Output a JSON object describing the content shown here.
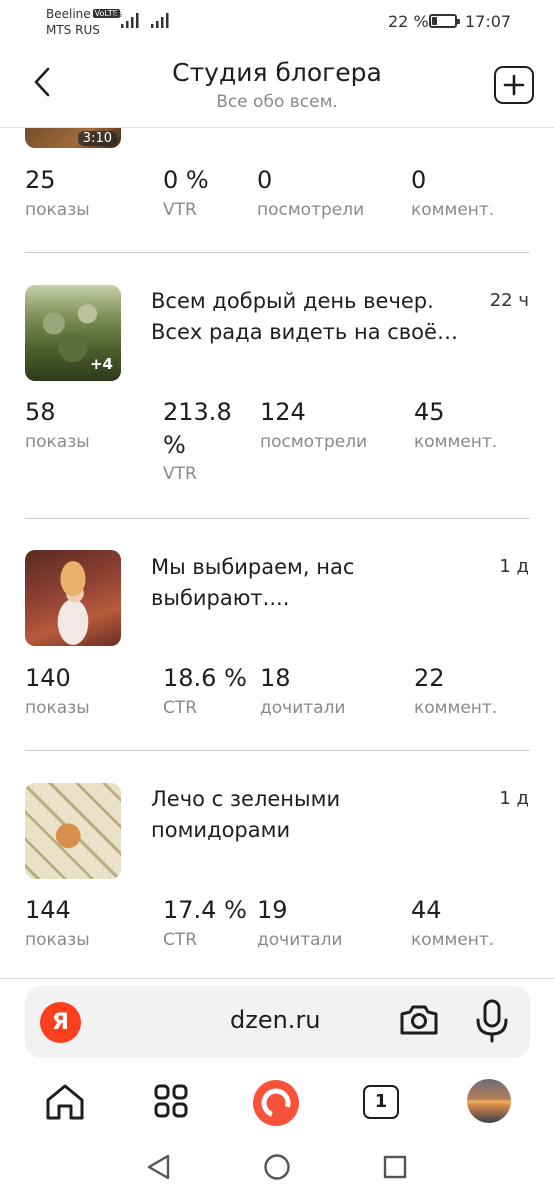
{
  "status_bar": {
    "carrier1": "Beeline",
    "volte": "VoLTE",
    "net_type": "4G",
    "carrier2": "MTS RUS",
    "battery_pct": "22 %",
    "battery_level": 0.22,
    "time": "17:07"
  },
  "header": {
    "title": "Студия блогера",
    "subtitle": "Все обо всем."
  },
  "posts": [
    {
      "thumb_duration": "3:10",
      "stats": [
        {
          "value": "25",
          "label": "показы"
        },
        {
          "value": "0 %",
          "label": "VTR"
        },
        {
          "value": "0",
          "label": "посмотрели"
        },
        {
          "value": "0",
          "label": "коммент."
        }
      ]
    },
    {
      "title_lines": [
        "Всем добрый день вечер.",
        "Всех рада видеть на своё…"
      ],
      "time": "22 ч",
      "thumb_badge": "+4",
      "stats": [
        {
          "value": "58",
          "label": "показы"
        },
        {
          "value_lines": [
            "213.8",
            "%"
          ],
          "label": "VTR"
        },
        {
          "value": "124",
          "label": "посмотрели"
        },
        {
          "value": "45",
          "label": "коммент."
        }
      ]
    },
    {
      "title_lines": [
        "Мы выбираем, нас",
        "выбирают...."
      ],
      "time": "1 д",
      "stats": [
        {
          "value": "140",
          "label": "показы"
        },
        {
          "value": "18.6 %",
          "label": "CTR"
        },
        {
          "value": "18",
          "label": "дочитали"
        },
        {
          "value": "22",
          "label": "коммент."
        }
      ]
    },
    {
      "title_lines": [
        "Лечо с зелеными",
        "помидорами"
      ],
      "time": "1 д",
      "stats": [
        {
          "value": "144",
          "label": "показы"
        },
        {
          "value": "17.4 %",
          "label": "CTR"
        },
        {
          "value": "19",
          "label": "дочитали"
        },
        {
          "value": "44",
          "label": "коммент."
        }
      ]
    }
  ],
  "browser": {
    "logo_letter": "Я",
    "url": "dzen.ru",
    "tabs_count": "1"
  },
  "colors": {
    "yandex_red": "#fc3f1d",
    "alice_red": "#f7523a",
    "text": "#1e1e1e",
    "muted": "#8a8a8a"
  }
}
